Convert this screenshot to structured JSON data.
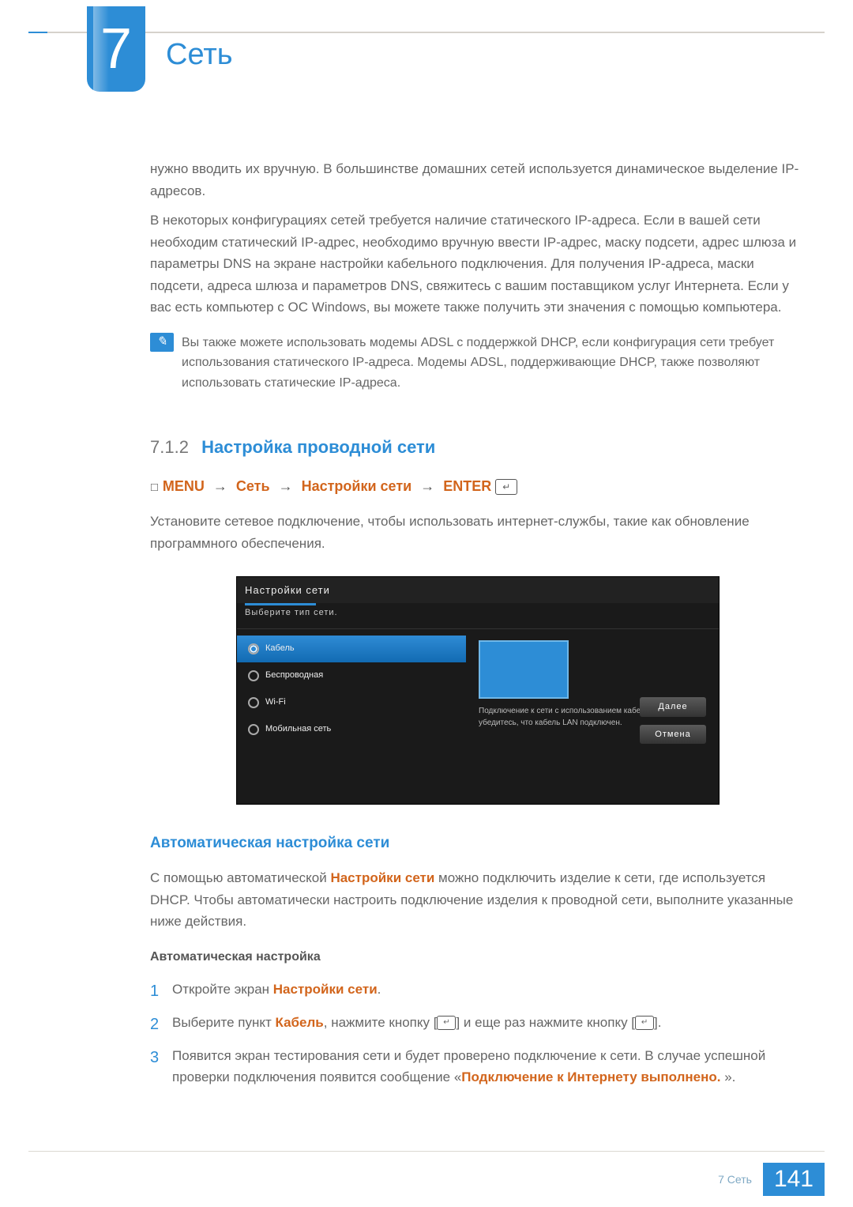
{
  "chapter": {
    "number": "7",
    "title": "Сеть"
  },
  "intro_paragraphs": [
    "нужно вводить их вручную. В большинстве домашних сетей используется динамическое выделение IP-адресов.",
    "В некоторых конфигурациях сетей требуется наличие статического IP-адреса. Если в вашей сети необходим статический IP-адрес, необходимо вручную ввести IP-адрес, маску подсети, адрес шлюза и параметры DNS на экране настройки кабельного подключения. Для получения IP-адреса, маски подсети, адреса шлюза и параметров DNS, свяжитесь с вашим поставщиком услуг Интернета. Если у вас есть компьютер с ОС Windows, вы можете также получить эти значения с помощью компьютера."
  ],
  "note": "Вы также можете использовать модемы ADSL с поддержкой DHCP, если конфигурация сети требует использования статического IP-адреса. Модемы ADSL, поддерживающие DHCP, также позволяют использовать статические IP-адреса.",
  "section": {
    "number": "7.1.2",
    "title": "Настройка проводной сети"
  },
  "menu_path": {
    "square": "☐",
    "m1": "MENU",
    "arrow": "→",
    "m2": "Сеть",
    "m3": "Настройки сети",
    "m4": "ENTER",
    "enter_glyph": "↵"
  },
  "after_path": "Установите сетевое подключение, чтобы использовать интернет-службы, такие как обновление программного обеспечения.",
  "screen": {
    "title": "Настройки сети",
    "subtitle": "Выберите тип сети.",
    "items": [
      {
        "label": "Кабель",
        "selected": true
      },
      {
        "label": "Беспроводная",
        "selected": false
      },
      {
        "label": "Wi-Fi",
        "selected": false
      },
      {
        "label": "Мобильная сеть",
        "selected": false
      }
    ],
    "right_note": "Подключение к сети с использованием кабеля LAN. Сначала убедитесь, что кабель LAN подключен.",
    "buttons": [
      "Далее",
      "Отмена"
    ]
  },
  "h3": "Автоматическая настройка сети",
  "auto_para_prefix": "С помощью автоматической ",
  "auto_para_em": "Настройки сети",
  "auto_para_suffix": " можно подключить изделие к сети, где используется DHCP. Чтобы автоматически настроить подключение изделия к проводной сети, выполните указанные ниже действия.",
  "h4": "Автоматическая настройка",
  "steps": {
    "s1a": "Откройте экран ",
    "s1b": "Настройки сети",
    "s1c": ".",
    "s2a": "Выберите пункт ",
    "s2b": "Кабель",
    "s2c": ", нажмите кнопку [",
    "s2d": "] и еще раз нажмите кнопку [",
    "s2e": "].",
    "s3a": "Появится экран тестирования сети и будет проверено подключение к сети. В случае успешной проверки подключения появится сообщение «",
    "s3b": "Подключение к Интернету выполнено.",
    "s3c": " »."
  },
  "footer": {
    "label": "7 Сеть",
    "page": "141"
  }
}
